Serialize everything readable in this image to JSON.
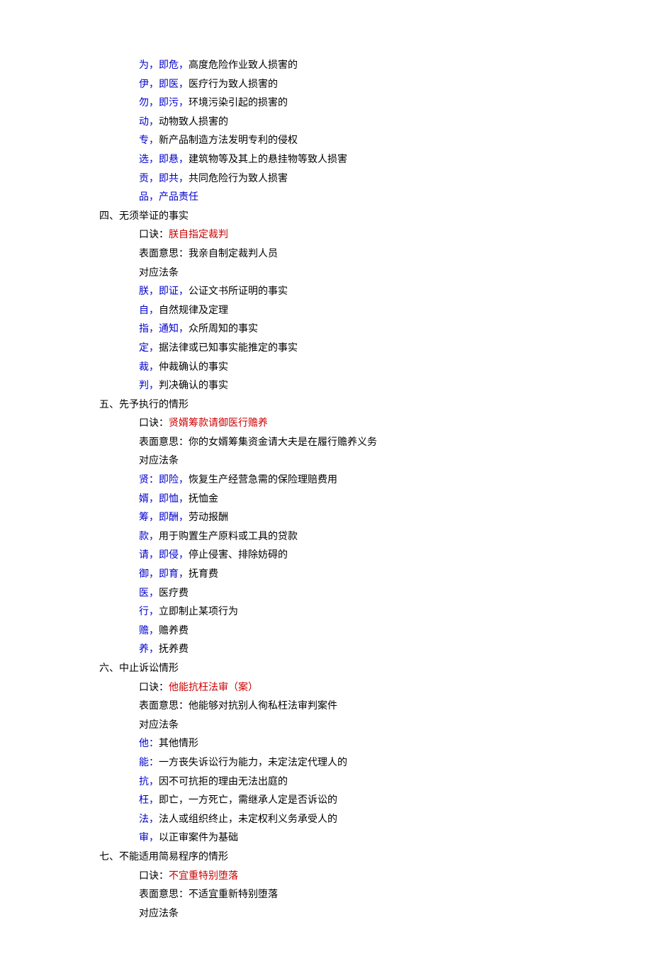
{
  "sections": [
    {
      "heading": null,
      "items": [
        {
          "key": "为，即危，",
          "text": "高度危险作业致人损害的",
          "keyColor": "blue"
        },
        {
          "key": "伊，即医，",
          "text": "医疗行为致人损害的",
          "keyColor": "blue"
        },
        {
          "key": "勿，即污，",
          "text": "环境污染引起的损害的",
          "keyColor": "blue"
        },
        {
          "key": "动，",
          "text": "动物致人损害的",
          "keyColor": "blue"
        },
        {
          "key": "专，",
          "text": "新产品制造方法发明专利的侵权",
          "keyColor": "blue"
        },
        {
          "key": "选，即悬，",
          "text": "建筑物等及其上的悬挂物等致人损害",
          "keyColor": "blue"
        },
        {
          "key": "贡，即共，",
          "text": "共同危险行为致人损害",
          "keyColor": "blue"
        },
        {
          "key": "品，产品责任",
          "text": "",
          "keyColor": "blue"
        }
      ]
    },
    {
      "heading": "四、无须举证的事实",
      "mnemonic_label": "口诀：",
      "mnemonic": "朕自指定裁判",
      "meaning_label": "表面意思：",
      "meaning": "我亲自制定裁判人员",
      "correspond": "对应法条",
      "items": [
        {
          "key": "朕，即证，",
          "text": "公证文书所证明的事实",
          "keyColor": "blue"
        },
        {
          "key": "自，",
          "text": "自然规律及定理",
          "keyColor": "blue"
        },
        {
          "key": "指，通知，",
          "text": "众所周知的事实",
          "keyColor": "blue"
        },
        {
          "key": "定，",
          "text": "据法律或已知事实能推定的事实",
          "keyColor": "blue"
        },
        {
          "key": "裁，",
          "text": "仲裁确认的事实",
          "keyColor": "blue"
        },
        {
          "key": "判，",
          "text": "判决确认的事实",
          "keyColor": "blue"
        }
      ]
    },
    {
      "heading": "五、先予执行的情形",
      "mnemonic_label": "口诀：",
      "mnemonic": "贤婿筹款请御医行赡养",
      "meaning_label": "表面意思：",
      "meaning": "你的女婿筹集资金请大夫是在履行赡养义务",
      "correspond": "对应法条",
      "items": [
        {
          "key": "贤：即险，",
          "text": "恢复生产经营急需的保险理赔费用",
          "keyColor": "blue"
        },
        {
          "key": "婿，即恤，",
          "text": "抚恤金",
          "keyColor": "blue"
        },
        {
          "key": "筹，即酬，",
          "text": "劳动报酬",
          "keyColor": "blue"
        },
        {
          "key": "款，",
          "text": "用于购置生产原料或工具的贷款",
          "keyColor": "blue"
        },
        {
          "key": "请，即侵，",
          "text": "停止侵害、排除妨碍的",
          "keyColor": "blue"
        },
        {
          "key": "御，即育，",
          "text": "抚育费",
          "keyColor": "blue"
        },
        {
          "key": "医，",
          "text": "医疗费",
          "keyColor": "blue"
        },
        {
          "key": "行，",
          "text": "立即制止某项行为",
          "keyColor": "blue"
        },
        {
          "key": "赡，",
          "text": "赡养费",
          "keyColor": "blue"
        },
        {
          "key": "养，",
          "text": "抚养费",
          "keyColor": "blue"
        }
      ]
    },
    {
      "heading": "六、中止诉讼情形",
      "mnemonic_label": "口诀：",
      "mnemonic": "他能抗枉法审（案）",
      "meaning_label": "表面意思：",
      "meaning": "他能够对抗别人徇私枉法审判案件",
      "correspond": "对应法条",
      "items": [
        {
          "key": "他：",
          "text": "其他情形",
          "keyColor": "blue"
        },
        {
          "key": "能：",
          "text": "一方丧失诉讼行为能力，未定法定代理人的",
          "keyColor": "blue"
        },
        {
          "key": "抗，",
          "text": "因不可抗拒的理由无法出庭的",
          "keyColor": "blue"
        },
        {
          "key": "枉，",
          "text": "即亡，一方死亡，需继承人定是否诉讼的",
          "keyColor": "blue"
        },
        {
          "key": "法，",
          "text": "法人或组织终止，未定权利义务承受人的",
          "keyColor": "blue"
        },
        {
          "key": "审，",
          "text": "以正审案件为基础",
          "keyColor": "blue"
        }
      ]
    },
    {
      "heading": "七、不能适用简易程序的情形",
      "mnemonic_label": "口诀：",
      "mnemonic": "不宜重特别堕落",
      "meaning_label": "表面意思：",
      "meaning": "不适宜重新特别堕落",
      "correspond": "对应法条",
      "items": []
    }
  ]
}
